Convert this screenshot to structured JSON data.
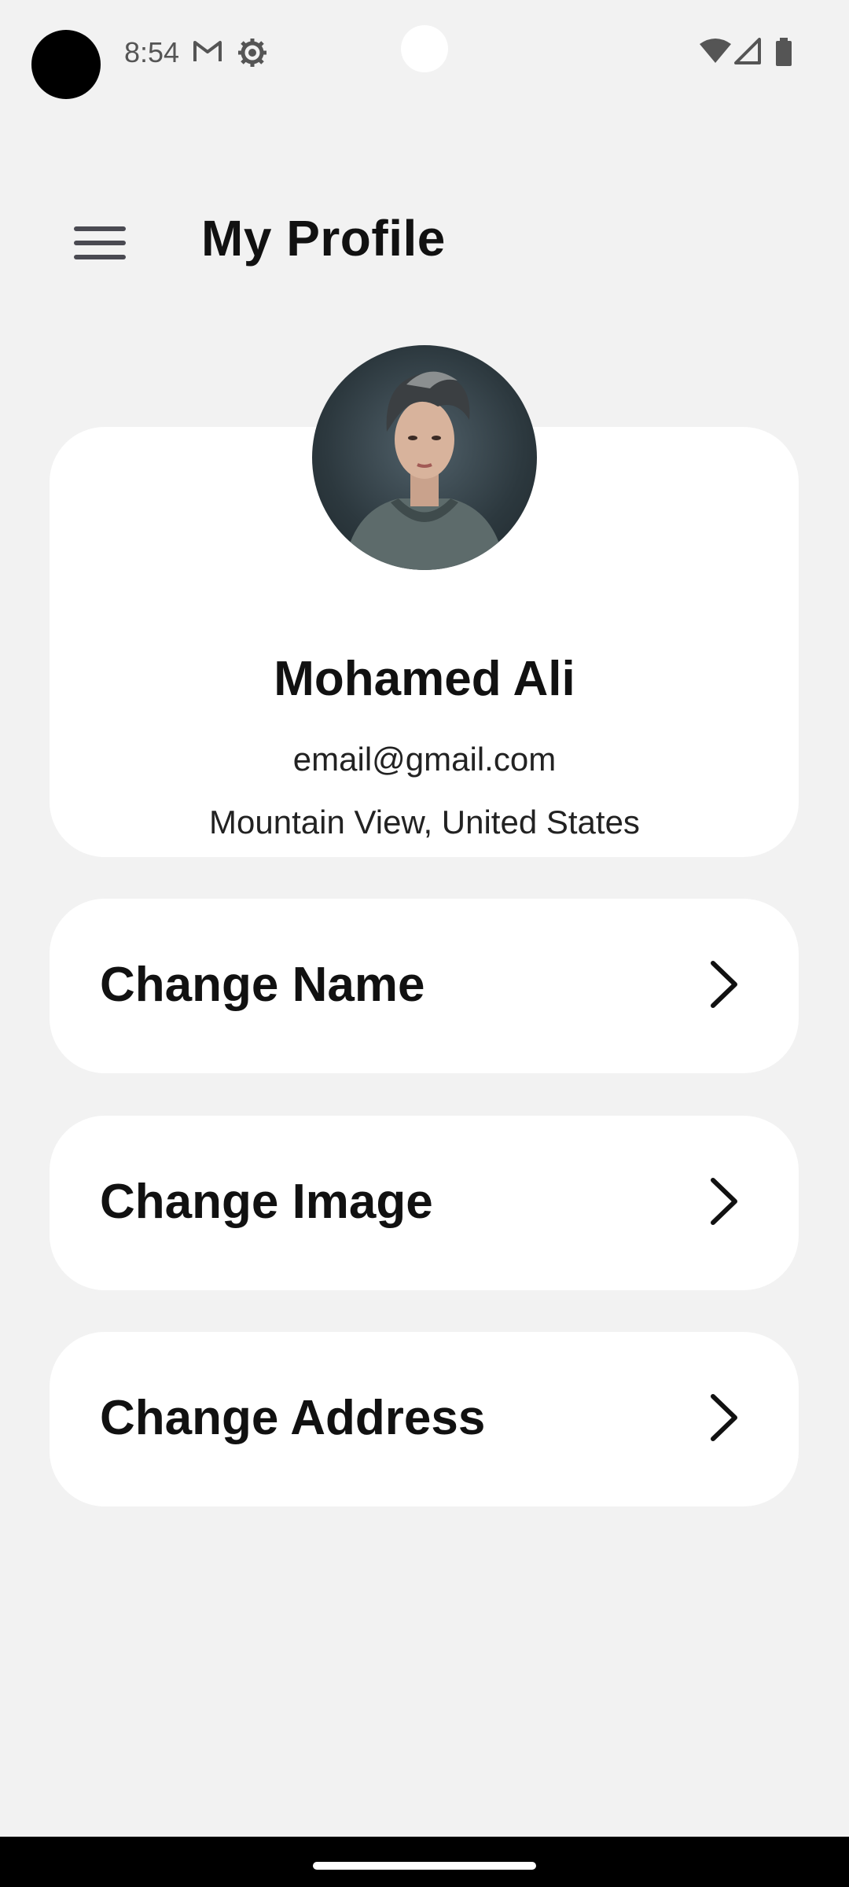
{
  "status_bar": {
    "time": "8:54",
    "icons": [
      "gmail-icon",
      "settings-icon",
      "wifi-icon",
      "signal-icon",
      "battery-icon"
    ]
  },
  "header": {
    "title": "My Profile",
    "menu_icon": "hamburger-menu-icon"
  },
  "profile": {
    "name": "Mohamed Ali",
    "email": "email@gmail.com",
    "location": "Mountain View, United States"
  },
  "options": [
    {
      "label": "Change Name",
      "icon": "chevron-right-icon"
    },
    {
      "label": "Change Image",
      "icon": "chevron-right-icon"
    },
    {
      "label": "Change Address",
      "icon": "chevron-right-icon"
    }
  ],
  "colors": {
    "background": "#f2f2f2",
    "card": "#ffffff",
    "text": "#111111"
  }
}
